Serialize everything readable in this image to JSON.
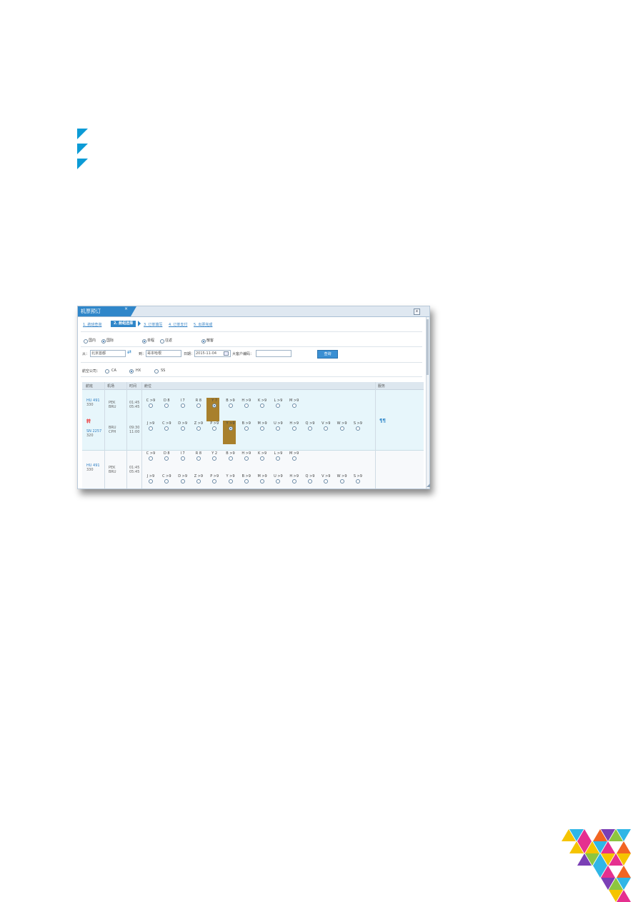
{
  "window": {
    "tab_title": "机票预订",
    "tab_close": "×",
    "close_button": "x"
  },
  "steps": {
    "s1": "1. 航班查询",
    "s2": "2. 舱组选择",
    "s3": "3. 订单填写",
    "s4": "4. 订单支付",
    "s5": "5. 出票完成"
  },
  "options": {
    "domestic": "国内",
    "international": "国际",
    "oneway": "单程",
    "roundtrip": "往返",
    "scatter": "散客"
  },
  "search": {
    "from_label": "从：",
    "from_value": "北京首都",
    "to_label": "到：",
    "to_value": "哥本哈根",
    "date_label": "日期：",
    "date_value": "2015-11-04",
    "bigclient_label": "大客户编码：",
    "bigclient_value": "",
    "query_button": "查询",
    "airline_label": "航空公司：",
    "airline_opt1": "CA",
    "airline_opt2": "HX",
    "airline_opt3": "SS"
  },
  "table": {
    "headers": {
      "flight": "航班",
      "airport": "机场",
      "time": "时间",
      "cabin": "舱位",
      "service": "服务"
    }
  },
  "row1": {
    "flight1": "HU 491",
    "plane1": "330",
    "dep1": "PEK",
    "arr1": "BRU",
    "time1a": "01:45",
    "time1b": "05:45",
    "transfer": "转",
    "flight2": "SN 2257",
    "plane2": "320",
    "dep2": "BRU",
    "arr2": "CPH",
    "time2a": "09:30",
    "time2b": "11:00",
    "seats1": [
      "C >9",
      "D 8",
      "I 7",
      "R 8",
      "Y 7",
      "B >9",
      "H >9",
      "K >9",
      "L >9",
      "M >9"
    ],
    "seats2": [
      "J >9",
      "C >9",
      "D >9",
      "Z >9",
      "P >9",
      "Y >9",
      "B >9",
      "M >9",
      "U >9",
      "H >9",
      "Q >9",
      "V >9",
      "W >9",
      "S >9"
    ],
    "service_icon": "meal-icon"
  },
  "row2": {
    "flight1": "HU 491",
    "plane1": "330",
    "dep1": "PEK",
    "arr1": "BRU",
    "time1a": "01:45",
    "time1b": "05:45",
    "seats1": [
      "C >9",
      "D 8",
      "I 7",
      "R 8",
      "Y 2",
      "B >9",
      "H >9",
      "K >9",
      "L >9",
      "M >9"
    ],
    "seats2": [
      "J >9",
      "C >9",
      "D >9",
      "Z >9",
      "P >9",
      "Y >9",
      "B >9",
      "M >9",
      "U >9",
      "H >9",
      "Q >9",
      "V >9",
      "W >9",
      "S >9"
    ]
  },
  "colors": {
    "accent": "#2f86c9",
    "bullet": "#0b9bd6",
    "selected_cabin": "#a8802c",
    "row_highlight": "#e7f6fb"
  }
}
